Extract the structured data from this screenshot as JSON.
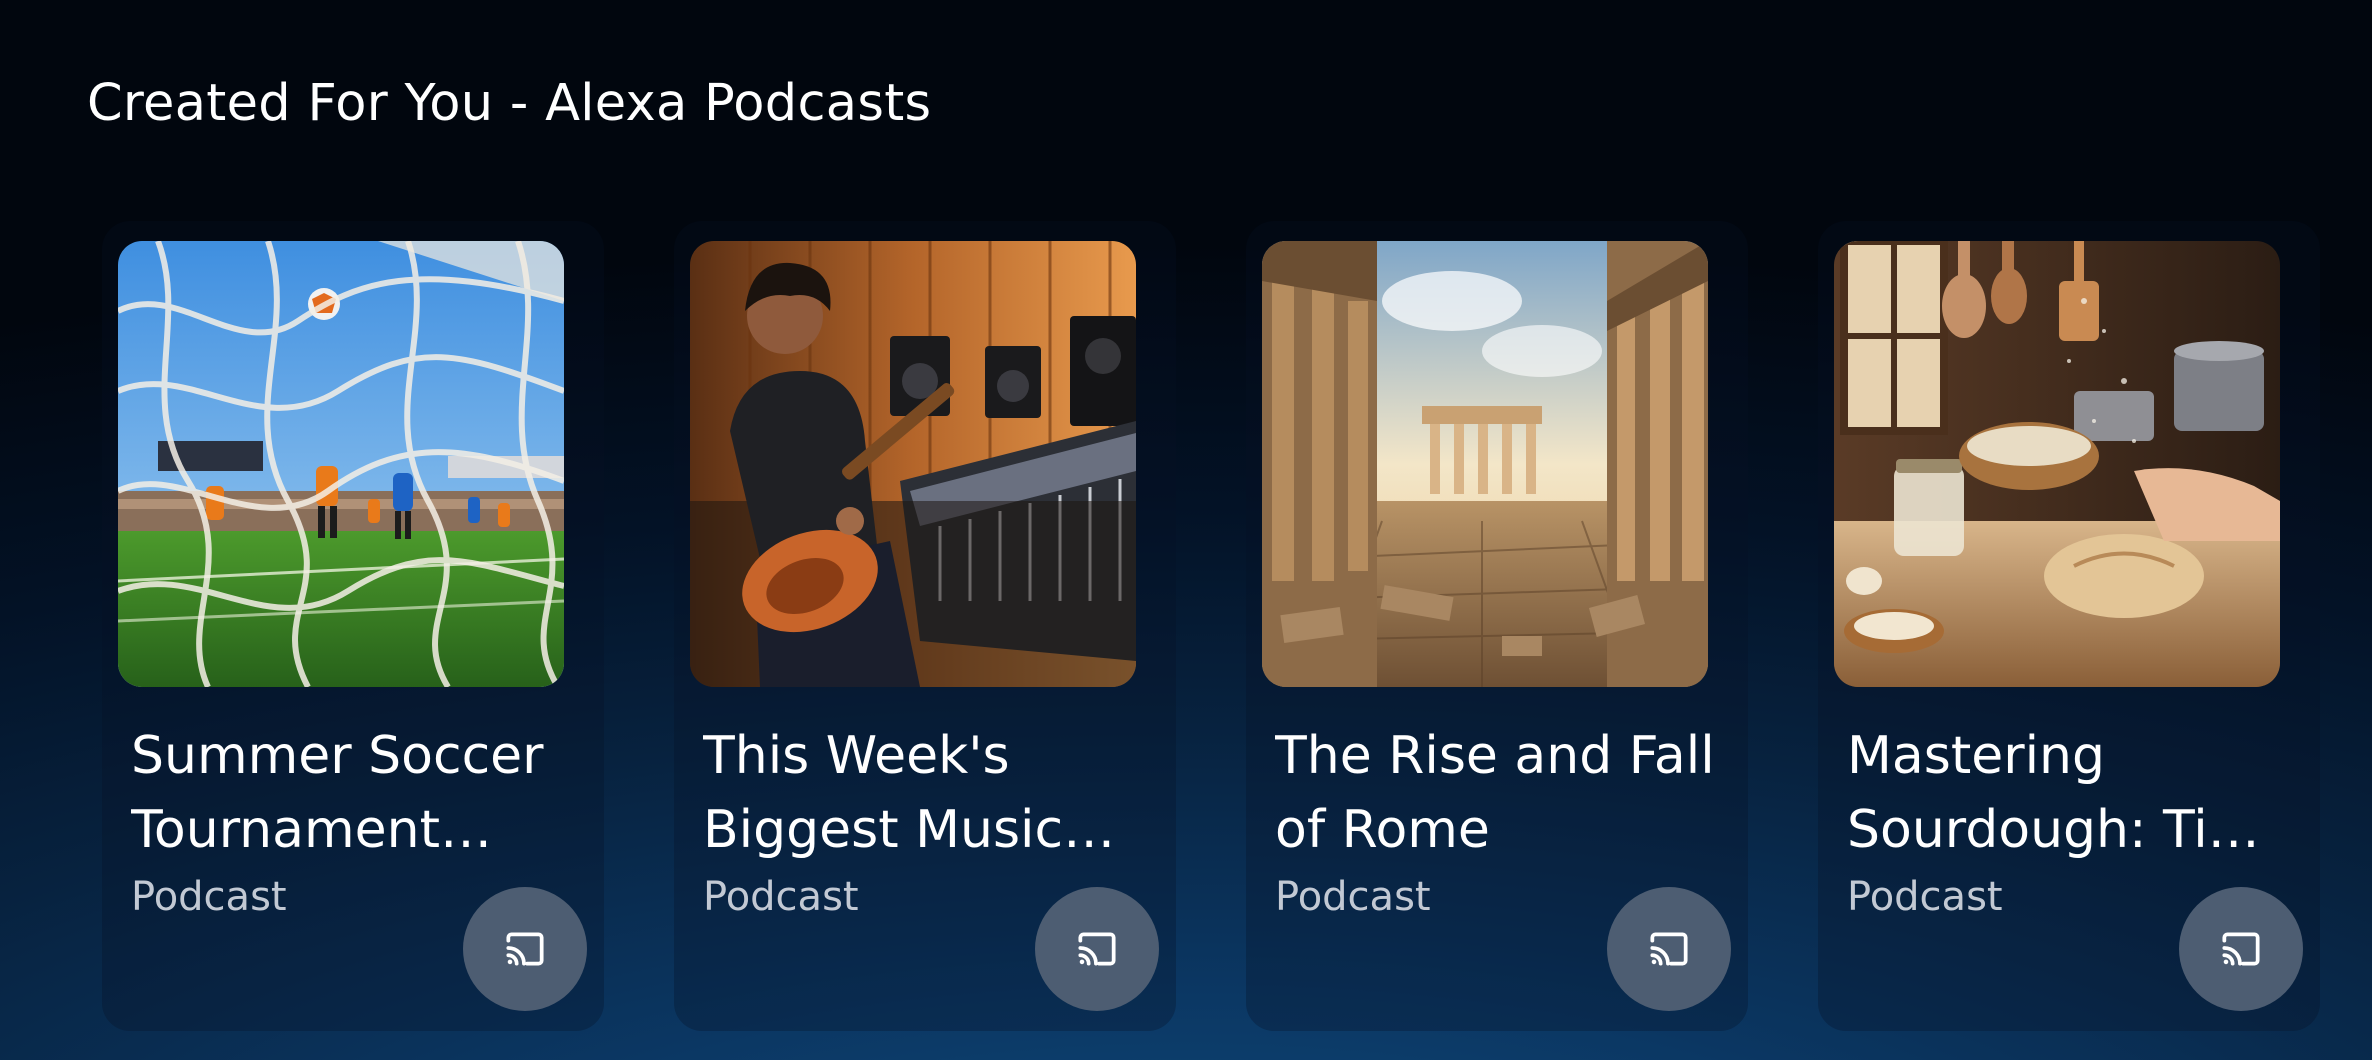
{
  "section": {
    "title": "Created For You - Alexa Podcasts"
  },
  "cards": [
    {
      "title": "Summer Soccer Tournament Highlights",
      "subtitle": "Podcast",
      "art_icon": "soccer-goal-net-illustration"
    },
    {
      "title": "This Week's Biggest Music News",
      "subtitle": "Podcast",
      "art_icon": "guitarist-in-studio-illustration"
    },
    {
      "title": "The Rise and Fall of Rome",
      "subtitle": "Podcast",
      "art_icon": "roman-forum-ruins-illustration"
    },
    {
      "title": "Mastering Sourdough: Tips and Tricks",
      "subtitle": "Podcast",
      "art_icon": "bread-baking-kitchen-illustration"
    }
  ],
  "colors": {
    "background_top": "#01060e",
    "background_bottom": "#0f4c7e",
    "cast_button": "#4d5d72",
    "subtitle_text": "#c2c9d4"
  }
}
